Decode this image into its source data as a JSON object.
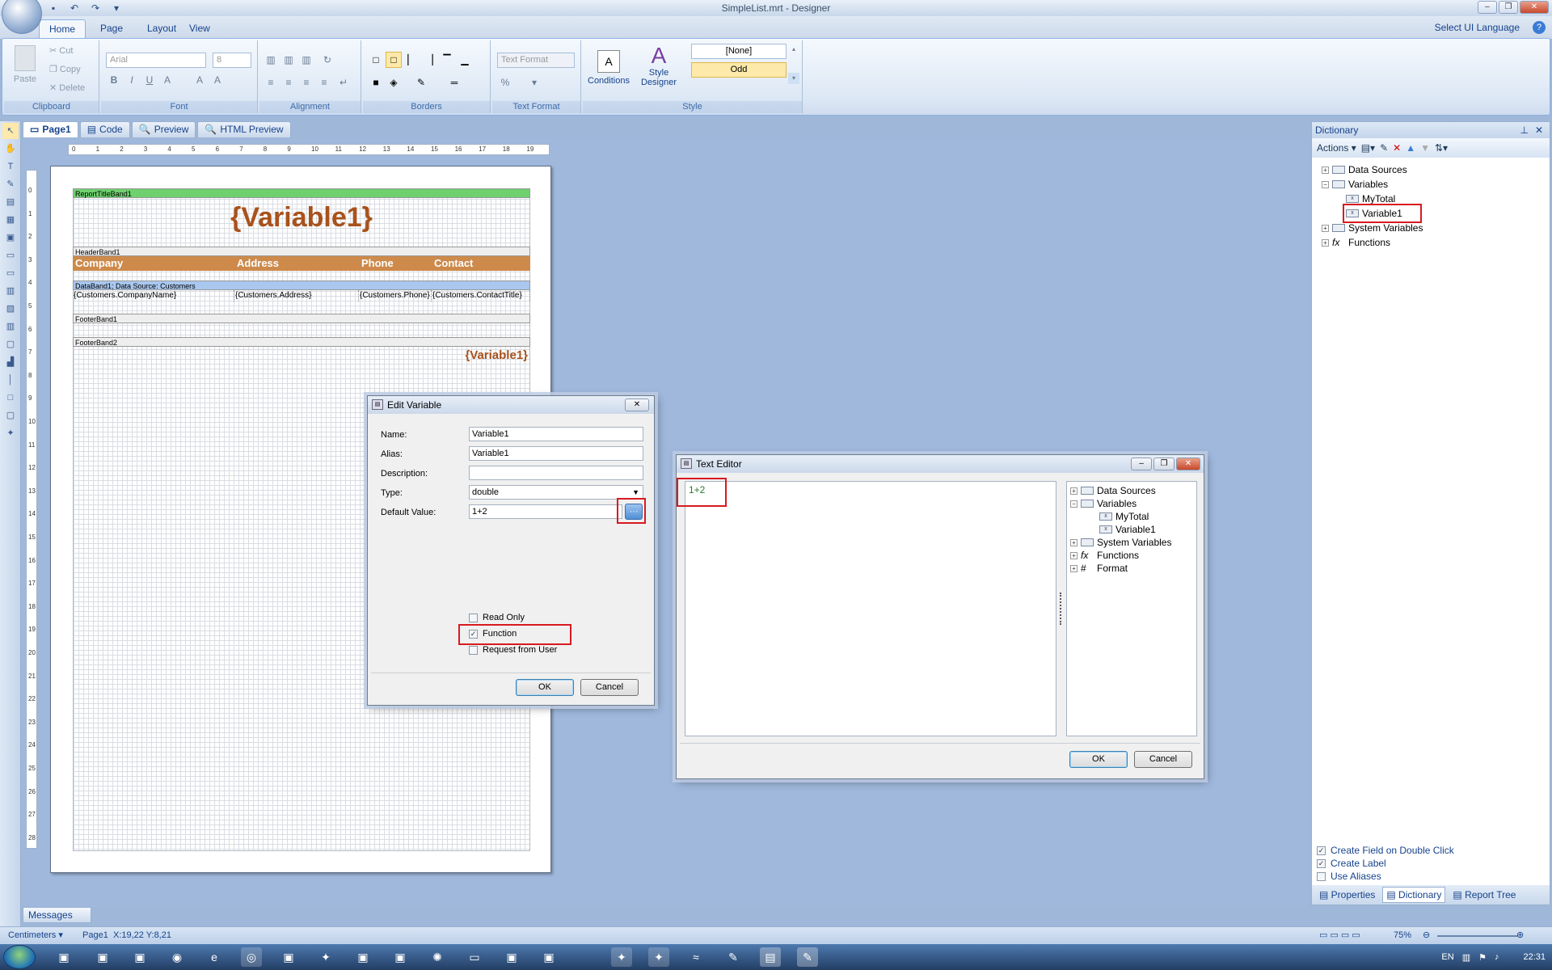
{
  "window": {
    "title": "SimpleList.mrt - Designer"
  },
  "ribbon": {
    "tabs": [
      "Home",
      "Page",
      "Layout",
      "View"
    ],
    "ui_language": "Select UI Language",
    "clipboard": {
      "label": "Clipboard",
      "paste": "Paste",
      "cut": "Cut",
      "copy": "Copy",
      "delete": "Delete"
    },
    "font": {
      "label": "Font",
      "family": "Arial",
      "size": "8"
    },
    "alignment": {
      "label": "Alignment"
    },
    "borders": {
      "label": "Borders"
    },
    "text_format": {
      "label": "Text Format",
      "combo": "Text Format"
    },
    "style": {
      "label": "Style",
      "conditions": "Conditions",
      "style_designer": "Style Designer",
      "none": "[None]",
      "odd": "Odd"
    }
  },
  "doc_tabs": [
    "Page1",
    "Code",
    "Preview",
    "HTML Preview"
  ],
  "ruler": {
    "h": [
      "0",
      "1",
      "2",
      "3",
      "4",
      "5",
      "6",
      "7",
      "8",
      "9",
      "10",
      "11",
      "12",
      "13",
      "14",
      "15",
      "16",
      "17",
      "18",
      "19"
    ]
  },
  "report": {
    "title_band": "ReportTitleBand1",
    "title_text": "{Variable1}",
    "header_band": "HeaderBand1",
    "headers": [
      "Company",
      "Address",
      "Phone",
      "Contact"
    ],
    "data_band": "DataBand1; Data Source: Customers",
    "data_cells": [
      "{Customers.CompanyName}",
      "{Customers.Address}",
      "{Customers.Phone}",
      "{Customers.ContactTitle}"
    ],
    "footer_band1": "FooterBand1",
    "footer_band2": "FooterBand2",
    "footer_text": "{Variable1}"
  },
  "dictionary": {
    "title": "Dictionary",
    "actions": "Actions",
    "tree": [
      "Data Sources",
      "Variables",
      "MyTotal",
      "Variable1",
      "System Variables",
      "Functions"
    ],
    "options": [
      "Create Field on Double Click",
      "Create Label",
      "Use Aliases"
    ],
    "tabs": [
      "Properties",
      "Dictionary",
      "Report Tree"
    ]
  },
  "edit_variable": {
    "title": "Edit Variable",
    "name_label": "Name:",
    "name": "Variable1",
    "alias_label": "Alias:",
    "alias": "Variable1",
    "description_label": "Description:",
    "description": "",
    "type_label": "Type:",
    "type": "double",
    "default_label": "Default Value:",
    "default": "1+2",
    "read_only": "Read Only",
    "function": "Function",
    "request": "Request from User",
    "ok": "OK",
    "cancel": "Cancel"
  },
  "text_editor": {
    "title": "Text Editor",
    "text": "1+2",
    "tree": [
      "Data Sources",
      "Variables",
      "MyTotal",
      "Variable1",
      "System Variables",
      "Functions",
      "Format"
    ],
    "ok": "OK",
    "cancel": "Cancel"
  },
  "messages": "Messages",
  "status": {
    "units": "Centimeters",
    "page": "Page1",
    "coords": "X:19,22  Y:8,21",
    "zoom": "75%"
  },
  "tray": {
    "lang": "EN",
    "time": "22:31"
  }
}
